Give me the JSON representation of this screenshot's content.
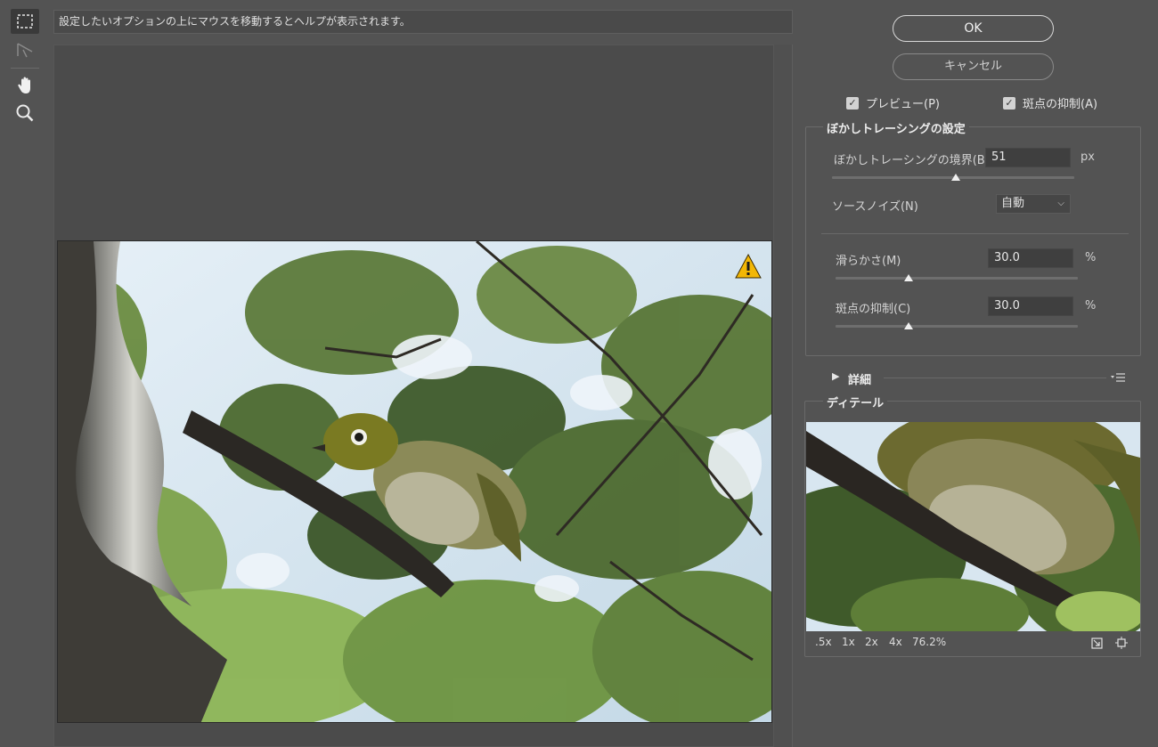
{
  "help_text": "設定したいオプションの上にマウスを移動するとヘルプが表示されます。",
  "buttons": {
    "ok": "OK",
    "cancel": "キャンセル"
  },
  "checkboxes": [
    {
      "label": "プレビュー(P)",
      "checked": true
    },
    {
      "label": "斑点の抑制(A)",
      "checked": true
    }
  ],
  "blur_tracing": {
    "title": "ぼかしトレーシングの設定",
    "boundary_label": "ぼかしトレーシングの境界(B)",
    "boundary_value": "51",
    "boundary_unit": "px",
    "boundary_slider_fraction": 0.51,
    "noise_label": "ソースノイズ(N)",
    "noise_value": "自動",
    "smooth_label": "滑らかさ(M)",
    "smooth_value": "30.0",
    "smooth_unit": "%",
    "smooth_slider_fraction": 0.3,
    "speckle_label": "斑点の抑制(C)",
    "speckle_value": "30.0",
    "speckle_unit": "%",
    "speckle_slider_fraction": 0.3
  },
  "advanced_label": "詳細",
  "detail": {
    "title": "ディテール",
    "zoom_options": [
      ".5x",
      "1x",
      "2x",
      "4x"
    ],
    "zoom_value": "76.2%"
  },
  "colors": {
    "background": "#535353",
    "warning": "#f2b705"
  },
  "icons": [
    "marquee-icon",
    "path-select-icon",
    "hand-icon",
    "zoom-icon",
    "warning-icon",
    "panel-menu-icon",
    "load-icon",
    "fit-icon"
  ]
}
